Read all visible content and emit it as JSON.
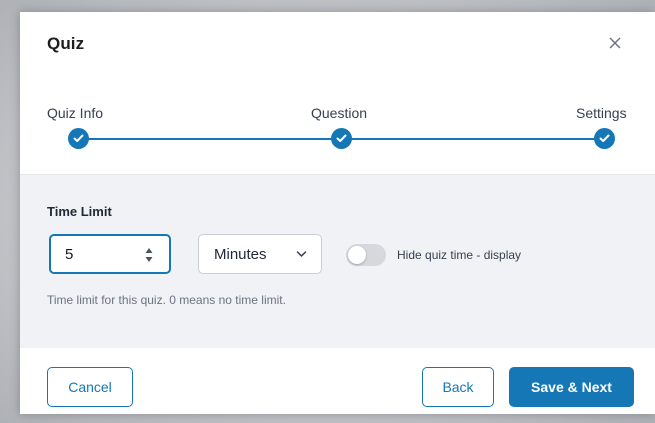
{
  "modal": {
    "title": "Quiz"
  },
  "stepper": {
    "steps": [
      {
        "label": "Quiz Info",
        "status": "completed"
      },
      {
        "label": "Question",
        "status": "completed"
      },
      {
        "label": "Settings",
        "status": "completed"
      }
    ],
    "accent_color": "#1577b6"
  },
  "settings": {
    "time_limit_label": "Time Limit",
    "time_limit_value": "5",
    "unit_selected": "Minutes",
    "hide_time_label": "Hide quiz time - display",
    "hide_time_enabled": false,
    "help_text": "Time limit for this quiz. 0 means no time limit."
  },
  "footer": {
    "cancel_label": "Cancel",
    "back_label": "Back",
    "next_label": "Save & Next"
  },
  "icons": {
    "close": "close-icon",
    "step_check": "check-icon",
    "spinner": "spinner-icon",
    "chevron": "chevron-down-icon"
  }
}
